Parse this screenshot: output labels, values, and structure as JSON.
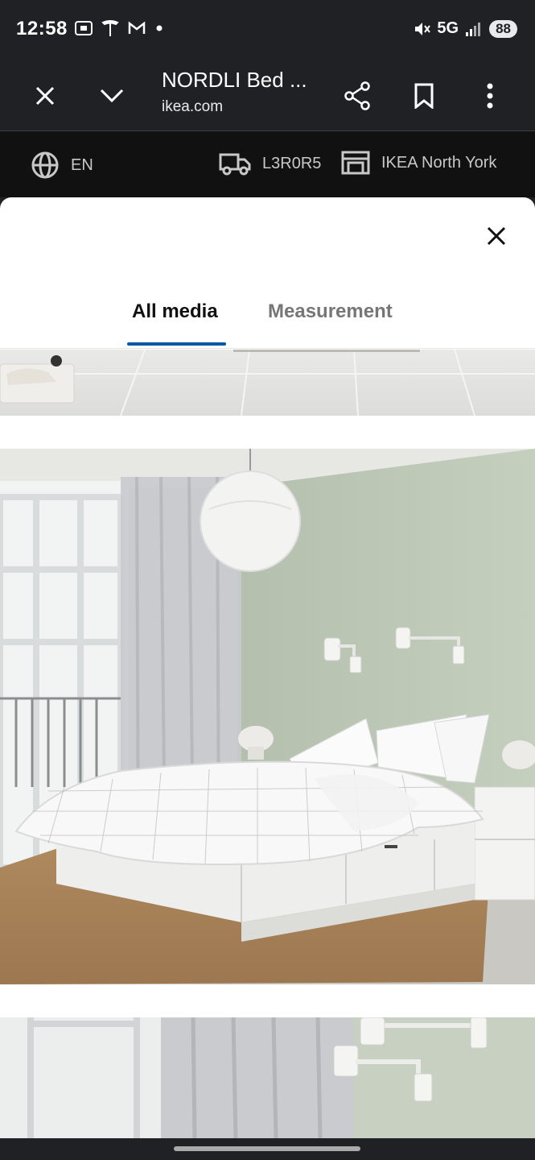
{
  "status_bar": {
    "time": "12:58",
    "network": "5G",
    "battery": "88"
  },
  "browser": {
    "page_title": "NORDLI Bed ...",
    "url": "ikea.com"
  },
  "ikea_bar": {
    "language": "EN",
    "postal_code": "L3R0R5",
    "store": "IKEA North York"
  },
  "media_viewer": {
    "tabs": [
      {
        "label": "All media",
        "active": true
      },
      {
        "label": "Measurement",
        "active": false
      }
    ]
  },
  "colors": {
    "accent": "#0058a3",
    "chrome_bg": "#202124",
    "ikea_bar_bg": "#111111"
  }
}
